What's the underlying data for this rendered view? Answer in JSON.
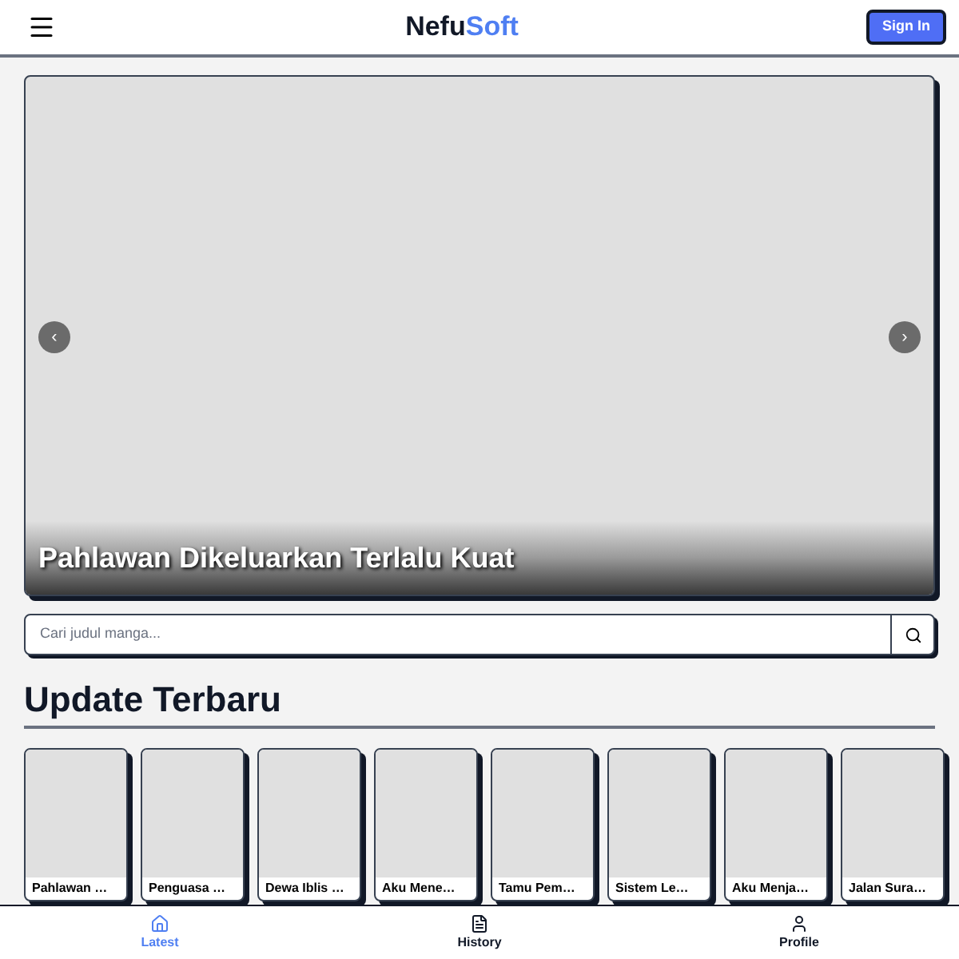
{
  "header": {
    "brand_start": "Nefu",
    "brand_end": "Soft",
    "sign_in": "Sign In"
  },
  "slider": {
    "title": "Pahlawan Dikeluarkan Terlalu Kuat",
    "prev": "‹",
    "next": "›"
  },
  "search": {
    "placeholder": "Cari judul manga..."
  },
  "section": {
    "title": "Update Terbaru"
  },
  "cards": [
    {
      "title": "Pahlawan …"
    },
    {
      "title": "Penguasa …"
    },
    {
      "title": "Dewa Iblis …"
    },
    {
      "title": "Aku Mene…"
    },
    {
      "title": "Tamu Pem…"
    },
    {
      "title": "Sistem Le…"
    },
    {
      "title": "Aku Menja…"
    },
    {
      "title": "Jalan Sura…"
    }
  ],
  "nav": [
    {
      "kind": "home",
      "label": "Latest",
      "selected": true
    },
    {
      "kind": "history",
      "label": "History",
      "selected": false
    },
    {
      "kind": "profile",
      "label": "Profile",
      "selected": false
    }
  ]
}
